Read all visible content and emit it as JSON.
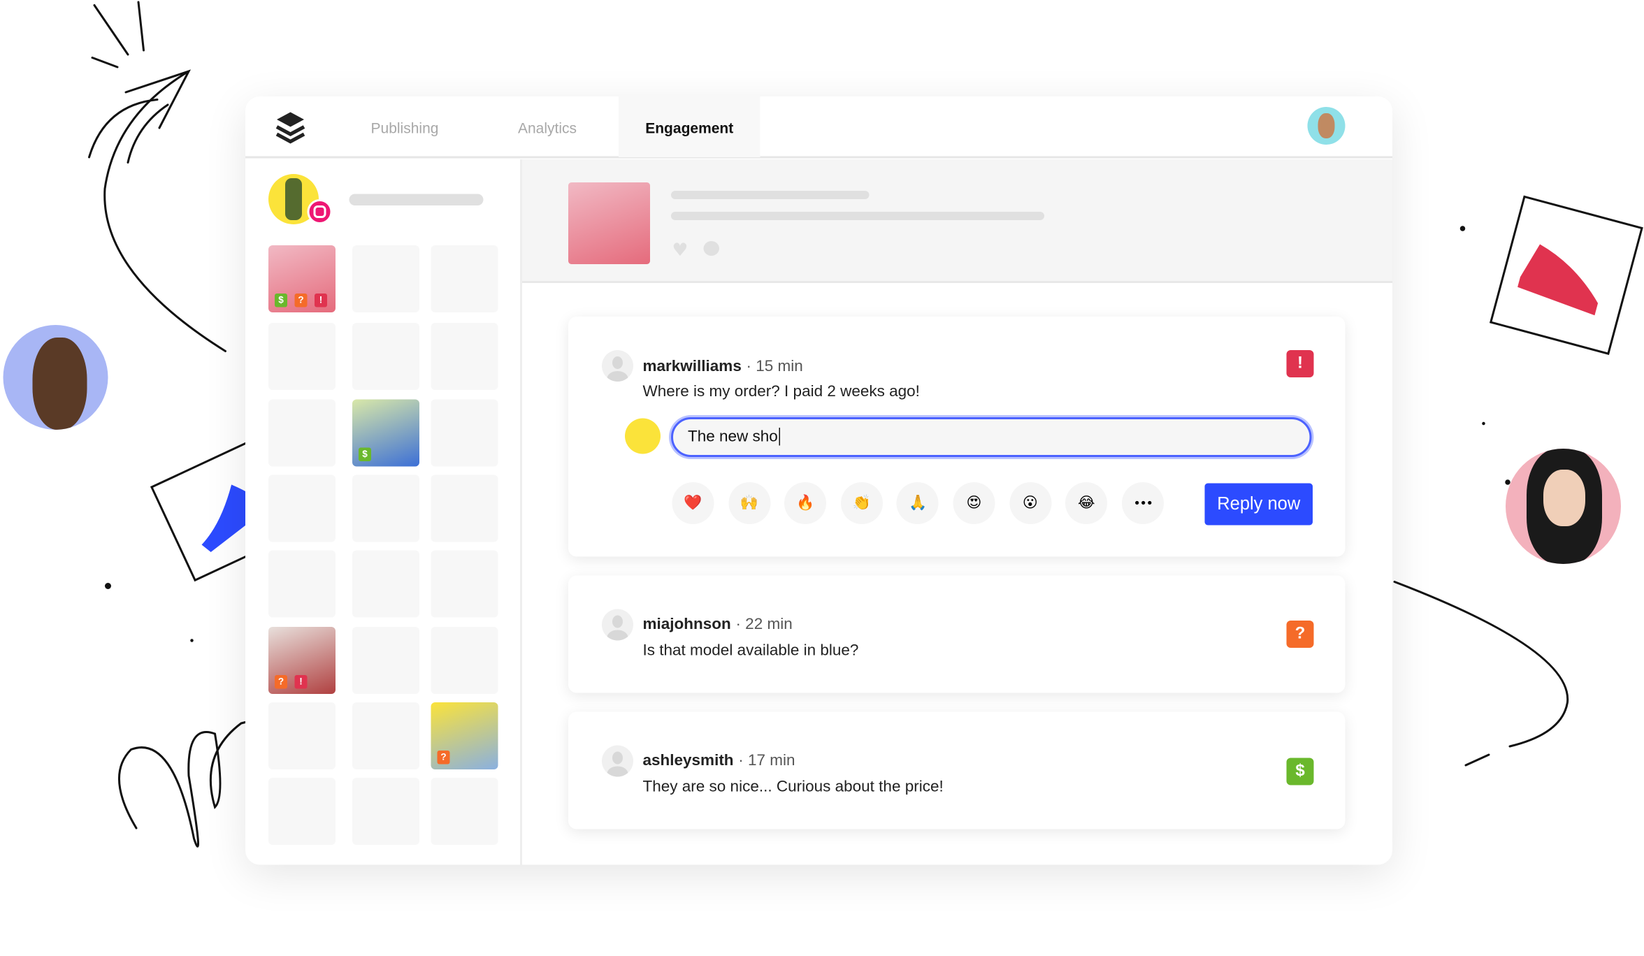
{
  "nav": {
    "tabs": [
      {
        "label": "Publishing"
      },
      {
        "label": "Analytics"
      },
      {
        "label": "Engagement",
        "active": true
      }
    ]
  },
  "icons": {
    "logo": "stacked-layers-logo",
    "profile_badge": "instagram-icon",
    "post_actions": [
      "heart-icon",
      "comment-icon"
    ]
  },
  "grid_badges": {
    "sales": "$",
    "question": "?",
    "urgent": "!"
  },
  "reply": {
    "input_value": "The new sho",
    "button_label": "Reply now",
    "emojis": [
      "❤️",
      "🙌",
      "🔥",
      "👏",
      "🙏",
      "😍",
      "😮",
      "😂"
    ],
    "more_label": "•••"
  },
  "comments": [
    {
      "username": "markwilliams",
      "time": "· 15 min",
      "text": "Where is my order? I paid 2 weeks ago!",
      "flag": "!",
      "flag_color": "#e0334f"
    },
    {
      "username": "miajohnson",
      "time": "· 22 min",
      "text": "Is that model available in blue?",
      "flag": "?",
      "flag_color": "#f56b29"
    },
    {
      "username": "ashleysmith",
      "time": "· 17 min",
      "text": "They are so nice... Curious about the price!",
      "flag": "$",
      "flag_color": "#6ab82c"
    }
  ],
  "colors": {
    "accent": "#2c4bff",
    "urgent": "#e0334f",
    "question": "#f56b29",
    "sales": "#6ab82c"
  }
}
